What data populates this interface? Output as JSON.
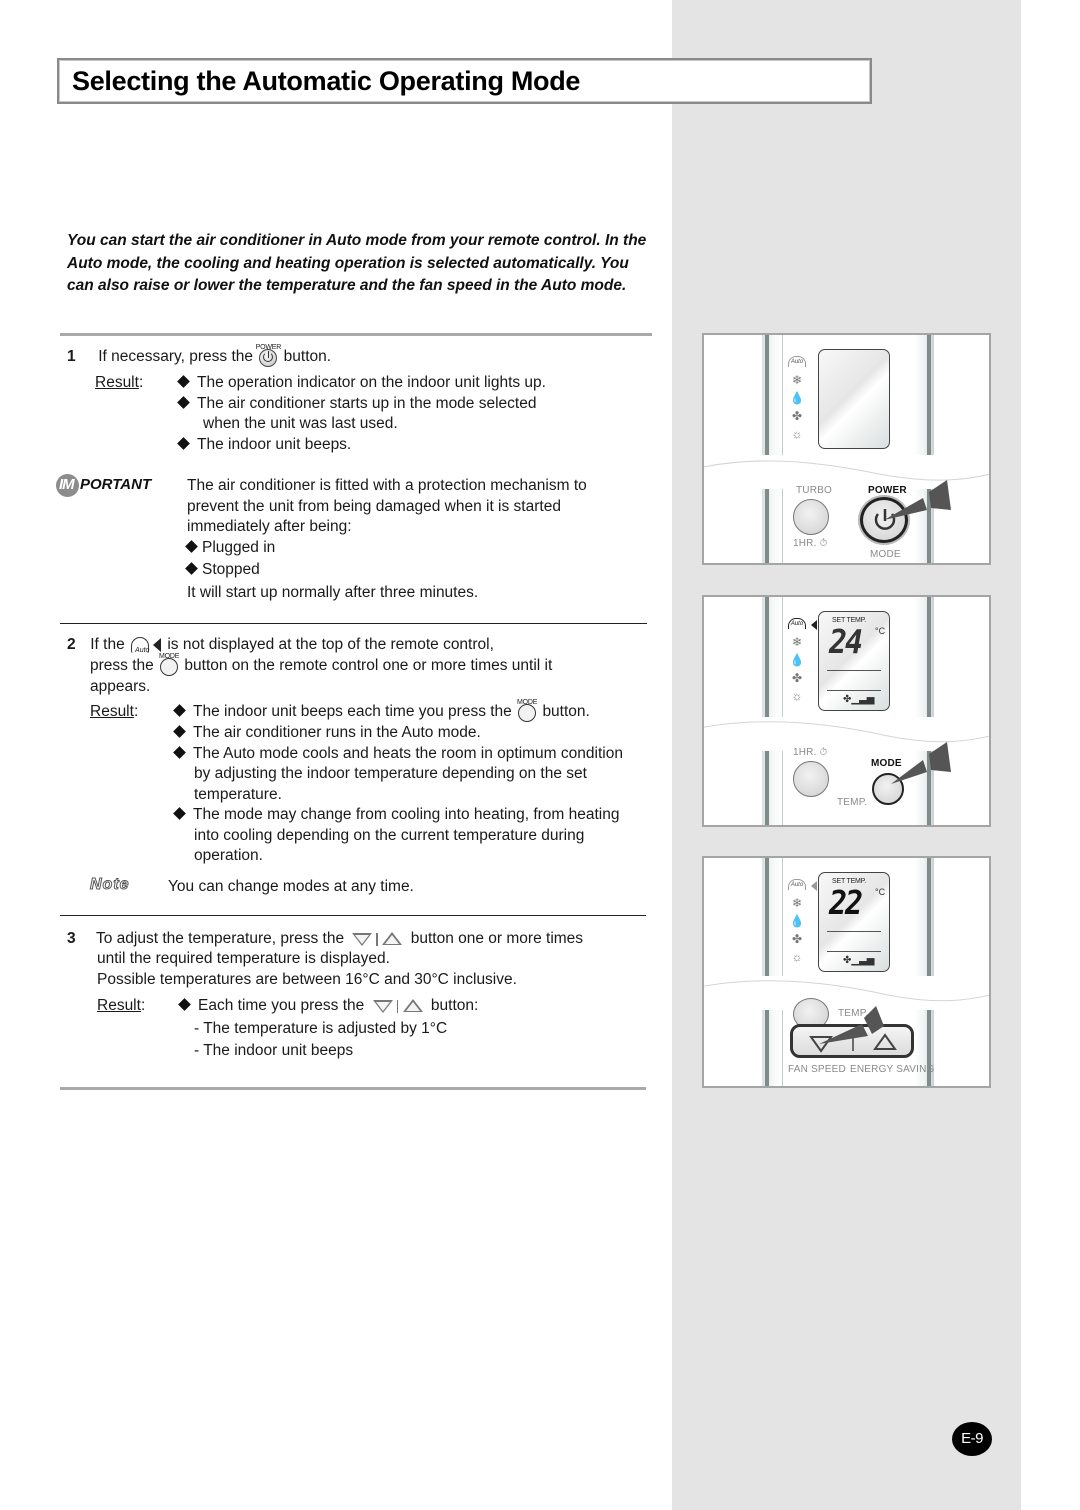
{
  "page": {
    "title": "Selecting the Automatic Operating Mode",
    "intro": "You can start the air conditioner in Auto mode from your remote control. In the Auto mode, the cooling and heating operation is selected automatically. You can also raise or lower the temperature and the fan speed in the Auto mode.",
    "page_number": "E-9"
  },
  "labels": {
    "result": "Result",
    "result_colon": ":",
    "important_prefix": "IM",
    "important_suffix": "PORTANT",
    "note": "Note",
    "power_cap": "POWER",
    "mode_cap": "MODE",
    "auto_cap": "Auto"
  },
  "step1": {
    "num": "1",
    "text_before": "If necessary, press the",
    "text_after": "button.",
    "results": [
      "The operation indicator on the indoor unit lights up.",
      "The air conditioner starts up in the mode selected",
      "when the unit was last used.",
      "The indoor unit beeps."
    ]
  },
  "important": {
    "lines": [
      "The air conditioner is fitted with a protection mechanism to",
      "prevent the unit from being damaged when it is started",
      "immediately after being:"
    ],
    "bullets": [
      "Plugged in",
      "Stopped"
    ],
    "footer": "It will start up normally after three minutes."
  },
  "step2": {
    "num": "2",
    "line1_before": "If the",
    "line1_after": "is not displayed at the top of the remote control,",
    "line2_before": "press the",
    "line2_after": "button on the remote control one or more times until it",
    "line3": "appears.",
    "result1_before": "The indoor unit beeps each time you press the",
    "result1_after": "button.",
    "result2": "The air conditioner runs in the Auto mode.",
    "result3": [
      "The Auto mode cools and heats the room in optimum condition",
      "by adjusting the indoor temperature depending on the set",
      "temperature."
    ],
    "result4": [
      "The mode may change from cooling into heating, from heating",
      "into cooling depending on the current temperature during",
      "operation."
    ],
    "note": "You can change modes at any time."
  },
  "step3": {
    "num": "3",
    "line1_before": "To adjust the temperature, press the",
    "line1_after": "button one or more times",
    "line2": "until the required temperature is displayed.",
    "line3": "Possible temperatures are between 16°C and 30°C inclusive.",
    "result_before": "Each time you press the",
    "result_after": "button:",
    "sub1": "- The temperature is adjusted by 1°C",
    "sub2": "- The indoor unit beeps"
  },
  "remote1": {
    "turbo": "TURBO",
    "power": "POWER",
    "timer": "1HR. ⏱",
    "mode": "MODE"
  },
  "remote2": {
    "set_temp": "SET TEMP.",
    "temp_value": "24",
    "unit": "°C",
    "timer": "1HR. ⏱",
    "mode": "MODE",
    "temp": "TEMP."
  },
  "remote3": {
    "set_temp": "SET TEMP.",
    "temp_value": "22",
    "unit": "°C",
    "temp": "TEMP.",
    "fan_speed": "FAN SPEED",
    "energy_saving": "ENERGY SAVING"
  },
  "mode_icons": [
    "auto-icon",
    "cool-icon",
    "dry-icon",
    "fan-icon",
    "heat-icon"
  ],
  "colors": {
    "sidebar_gray": "#e4e4e4",
    "rule_gray": "#a9a9a9",
    "badge_gray": "#8c8c8c"
  }
}
